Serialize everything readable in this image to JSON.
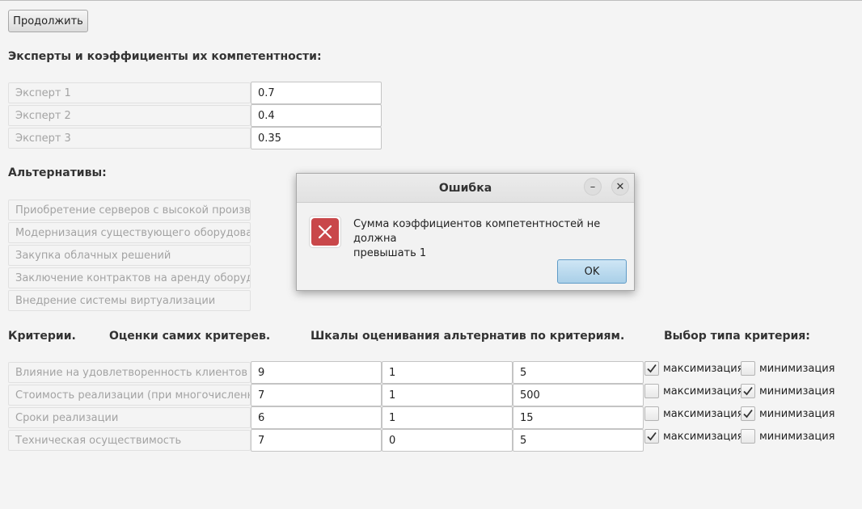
{
  "continue_button": "Продолжить",
  "experts": {
    "heading": "Эксперты и коэффициенты их компетентности:",
    "rows": [
      {
        "name": "Эксперт 1",
        "value": "0.7"
      },
      {
        "name": "Эксперт 2",
        "value": "0.4"
      },
      {
        "name": "Эксперт 3",
        "value": "0.35"
      }
    ]
  },
  "alternatives": {
    "heading": "Альтернативы:",
    "items": [
      "Приобретение серверов с высокой произво",
      "Модернизация существующего оборудован",
      "Закупка облачных решений",
      "Заключение контрактов на аренду оборудов",
      "Внедрение системы виртуализации"
    ]
  },
  "criteria": {
    "headers": {
      "criteria": "Критерии.",
      "estimates": "Оценки самих критерев.",
      "scales": "Шкалы оценивания альтернатив по критериям.",
      "type": "Выбор типа критерия:"
    },
    "max_label": "максимизация",
    "min_label": "минимизация",
    "rows": [
      {
        "name": "Влияние на удовлетворенность клиентов",
        "estimate": "9",
        "scale_min": "1",
        "scale_max": "5",
        "maximize": true,
        "minimize": false
      },
      {
        "name": "Стоимость реализации (при многочисленны",
        "estimate": "7",
        "scale_min": "1",
        "scale_max": "500",
        "maximize": false,
        "minimize": true
      },
      {
        "name": "Сроки реализации",
        "estimate": "6",
        "scale_min": "1",
        "scale_max": "15",
        "maximize": false,
        "minimize": true
      },
      {
        "name": "Техническая осуществимость",
        "estimate": "7",
        "scale_min": "0",
        "scale_max": "5",
        "maximize": true,
        "minimize": false
      }
    ]
  },
  "dialog": {
    "title": "Ошибка",
    "message_line1": "Сумма коэффициентов компетентностей не должна",
    "message_line2": "превышать 1",
    "ok_label": "OK",
    "minimize_glyph": "–",
    "close_glyph": "✕",
    "icon": "error-icon",
    "icon_color": "#c9474a"
  }
}
